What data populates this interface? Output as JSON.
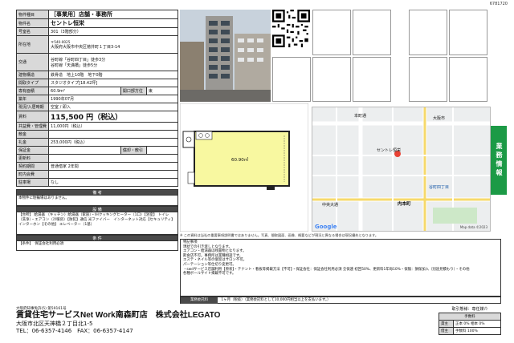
{
  "doc_id": "6781720",
  "table": {
    "rows": [
      {
        "label": "物件種目",
        "value": "［事業用］店舗・事務所"
      },
      {
        "label": "物件名",
        "value": "セントレ恒栄"
      },
      {
        "label": "号室名",
        "value": "301（3階部分）"
      },
      {
        "label": "所在地",
        "value_small": "〒540-0025",
        "value": "大阪府大阪市中央区徳井町１丁目3-14"
      },
      {
        "label": "交通",
        "lines": [
          "谷町線「谷町四丁目」徒歩3分",
          "谷町線「天満橋」徒歩5分"
        ]
      },
      {
        "label": "建物構造",
        "value": "鉄骨造　地上10階　地下0階"
      },
      {
        "label": "間取タイプ",
        "value": "スタジオタイプ[18.42坪]"
      },
      {
        "label": "専有面積",
        "value": "60.9m²",
        "label2": "開口部方位",
        "value2": "東"
      },
      {
        "label": "築年",
        "value": "1990年07月"
      },
      {
        "label": "現況/入居時期",
        "value": "空室 / 即入"
      },
      {
        "label": "賃料",
        "value": "115,500 円（税込）"
      },
      {
        "label": "共益費・管理費",
        "value": "11,000円（税込）"
      },
      {
        "label": "敷金",
        "value": ""
      },
      {
        "label": "礼金",
        "value": "253,000円（税込）"
      },
      {
        "label": "保証金",
        "value": "",
        "label2": "償却・敷引",
        "value2": ""
      },
      {
        "label": "更新料",
        "value": ""
      },
      {
        "label": "契約期間",
        "value": "普通借家 2年間"
      },
      {
        "label": "町内会費",
        "value": ""
      },
      {
        "label": "駐車場",
        "value": "なし"
      }
    ]
  },
  "remarks": {
    "title": "備 考",
    "text": "本物件に駐輪場はありません。"
  },
  "facilities": {
    "title": "設 備",
    "text": "【台所】 給湯器 （キッチン）給湯器（家族）・IHクッキングヒーター（1口）【浴室】 トイレ（洗浄）・エアコン（冷暖房）【防犯】通信 光ファイバー　インターネット対応【セキュリティ】インターホン【その他】 エレベーター（1基）"
  },
  "conditions": {
    "title": "条 件",
    "text": "【条件】　保証会社利用必須"
  },
  "floorplan": {
    "area_label": "60.90㎡"
  },
  "map": {
    "labels": [
      "本町通",
      "内本町",
      "谷町四丁目",
      "中央大通",
      "大阪市",
      "セントレ恒栄"
    ],
    "google": "Google",
    "copyright": "Map data ©2023"
  },
  "side_tab": "業務情報",
  "notes": {
    "text": "特記事項\n現状での引き渡しとなります。\nエアコン・給湯器は残置物となります。\n飲食店不可。事務所は業種相談です。\nエステ・ネイル等の個室はサロン不可。\nパーテーション等仕切り変更可。\n・swdサービス店舗利用【原状】・テナント・看板等掲載方法【不可】・保証会社：保証会社利用必須 全保連 初回50%、更新料1年毎10%・保険：損保加入（別途見積もり）・その他\n各種ボールサイト掲載不可です。",
    "caption": "※ この資料は当社の重要事項説明書ではありません。写真、間取図面、画像、概要などが現況と異なる場合は現況優先となります。",
    "footer_label": "業務委託料",
    "footer_value": "1ヶ月（税抜）（業務委託料として10,000円相当以上を支払います。）"
  },
  "company": {
    "license": "大阪府知事免許(5) 第59161号",
    "name": "賃貸住宅サービスNet Work南森町店　株式会社LEGATO",
    "address": "大阪市北区天神橋２丁目北1-5",
    "tel": "TEL：06-6357-4146　FAX：06-6357-4147"
  },
  "fee": {
    "title": "取引態様：専任媒介",
    "header": "手数料",
    "rows": [
      {
        "label": "貸主",
        "value": "正本 0%  相本 0%"
      },
      {
        "label": "借主",
        "value": "手数料 100%"
      }
    ]
  }
}
